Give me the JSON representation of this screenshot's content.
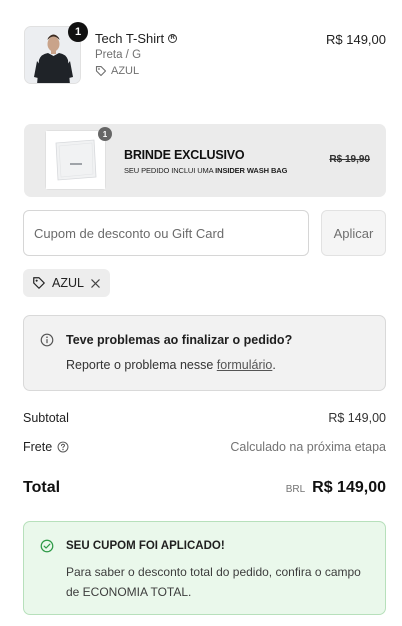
{
  "cart_item": {
    "quantity": "1",
    "name": "Tech T-Shirt",
    "variant": "Preta / G",
    "discount_tag": "AZUL",
    "price": "R$ 149,00"
  },
  "gift": {
    "quantity": "1",
    "title": "BRINDE EXCLUSIVO",
    "subtitle_prefix": "SEU PEDIDO INCLUI UMA",
    "subtitle_bold": "INSIDER WASH BAG",
    "old_price": "R$ 19,90"
  },
  "coupon": {
    "placeholder": "Cupom de desconto ou Gift Card",
    "apply_label": "Aplicar",
    "applied_code": "AZUL"
  },
  "problem": {
    "title": "Teve problemas ao finalizar o pedido?",
    "text_prefix": "Reporte o problema nesse ",
    "link_text": "formulário",
    "text_suffix": "."
  },
  "summary": {
    "subtotal_label": "Subtotal",
    "subtotal_value": "R$ 149,00",
    "shipping_label": "Frete",
    "shipping_value": "Calculado na próxima etapa",
    "total_label": "Total",
    "currency": "BRL",
    "total_value": "R$ 149,00"
  },
  "success": {
    "title": "SEU CUPOM FOI APLICADO!",
    "text": "Para saber o desconto total do pedido, confira o campo de ECONOMIA TOTAL."
  },
  "colors": {
    "success_bg": "#eaf8eb",
    "success_border": "#b7e0bb",
    "success_icon": "#2e9a47"
  }
}
